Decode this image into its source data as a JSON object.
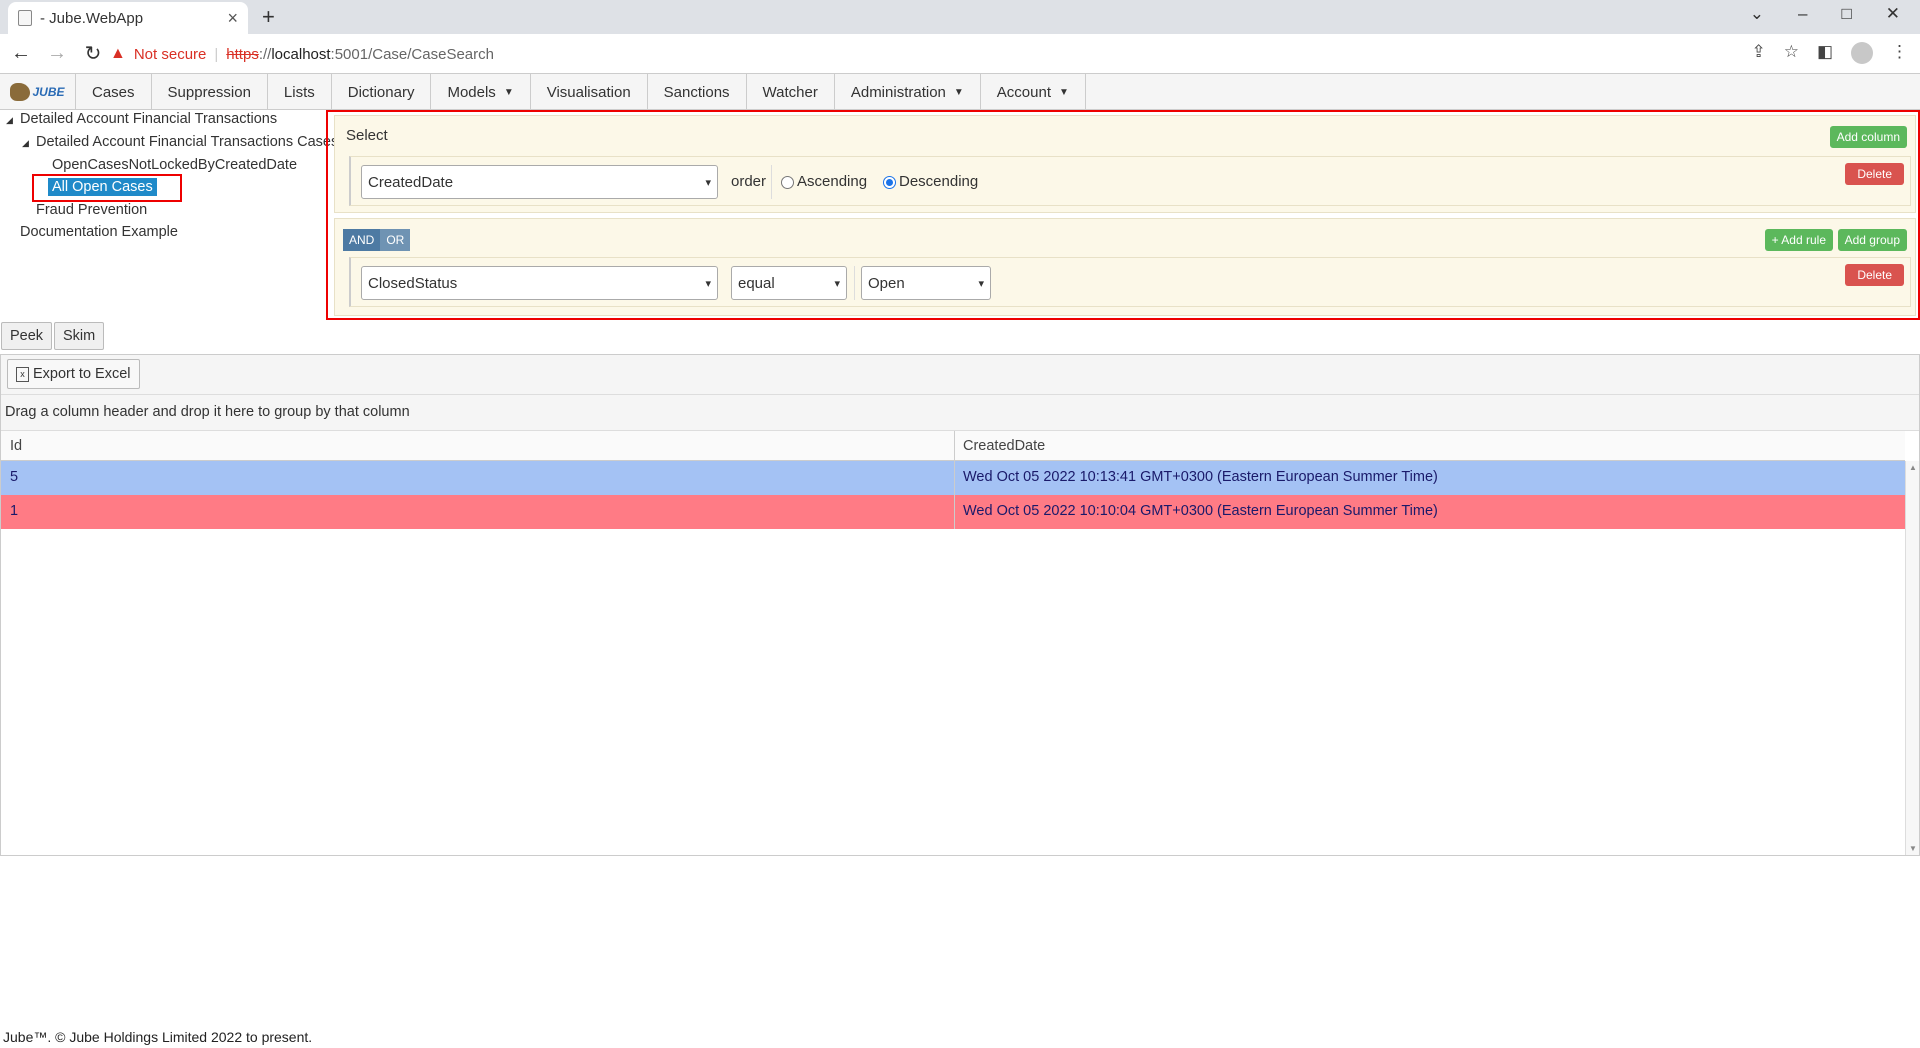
{
  "browser": {
    "tab_title": "- Jube.WebApp",
    "url_scheme": "https",
    "url_sep": "://",
    "url_host": "localhost",
    "url_path": ":5001/Case/CaseSearch",
    "not_secure": "Not secure"
  },
  "nav": {
    "logo_text": "JUBE",
    "items": [
      "Cases",
      "Suppression",
      "Lists",
      "Dictionary",
      "Models",
      "Visualisation",
      "Sanctions",
      "Watcher",
      "Administration",
      "Account"
    ]
  },
  "tree": {
    "root1": "Detailed Account Financial Transactions",
    "child1": "Detailed Account Financial Transactions Cases",
    "leaf1": "OpenCasesNotLockedByCreatedDate",
    "leaf2": "All Open Cases",
    "child2": "Fraud Prevention",
    "root2": "Documentation Example"
  },
  "query": {
    "select_label": "Select",
    "add_column": "Add column",
    "column_value": "CreatedDate",
    "order_label": "order",
    "ascending": "Ascending",
    "descending": "Descending",
    "delete": "Delete",
    "and": "AND",
    "or": "OR",
    "add_rule": "+ Add rule",
    "add_group": "Add group",
    "rule_field": "ClosedStatus",
    "rule_operator": "equal",
    "rule_value": "Open"
  },
  "actions": {
    "peek": "Peek",
    "skim": "Skim",
    "export": "Export to Excel"
  },
  "grid": {
    "grouping_hint": "Drag a column header and drop it here to group by that column",
    "columns": [
      "Id",
      "CreatedDate"
    ],
    "rows": [
      {
        "id": "5",
        "created": "Wed Oct 05 2022 10:13:41 GMT+0300 (Eastern European Summer Time)",
        "color": "#a4c2f4"
      },
      {
        "id": "1",
        "created": "Wed Oct 05 2022 10:10:04 GMT+0300 (Eastern European Summer Time)",
        "color": "#ff7b85"
      }
    ]
  },
  "footer": "Jube™. © Jube Holdings Limited 2022 to present."
}
